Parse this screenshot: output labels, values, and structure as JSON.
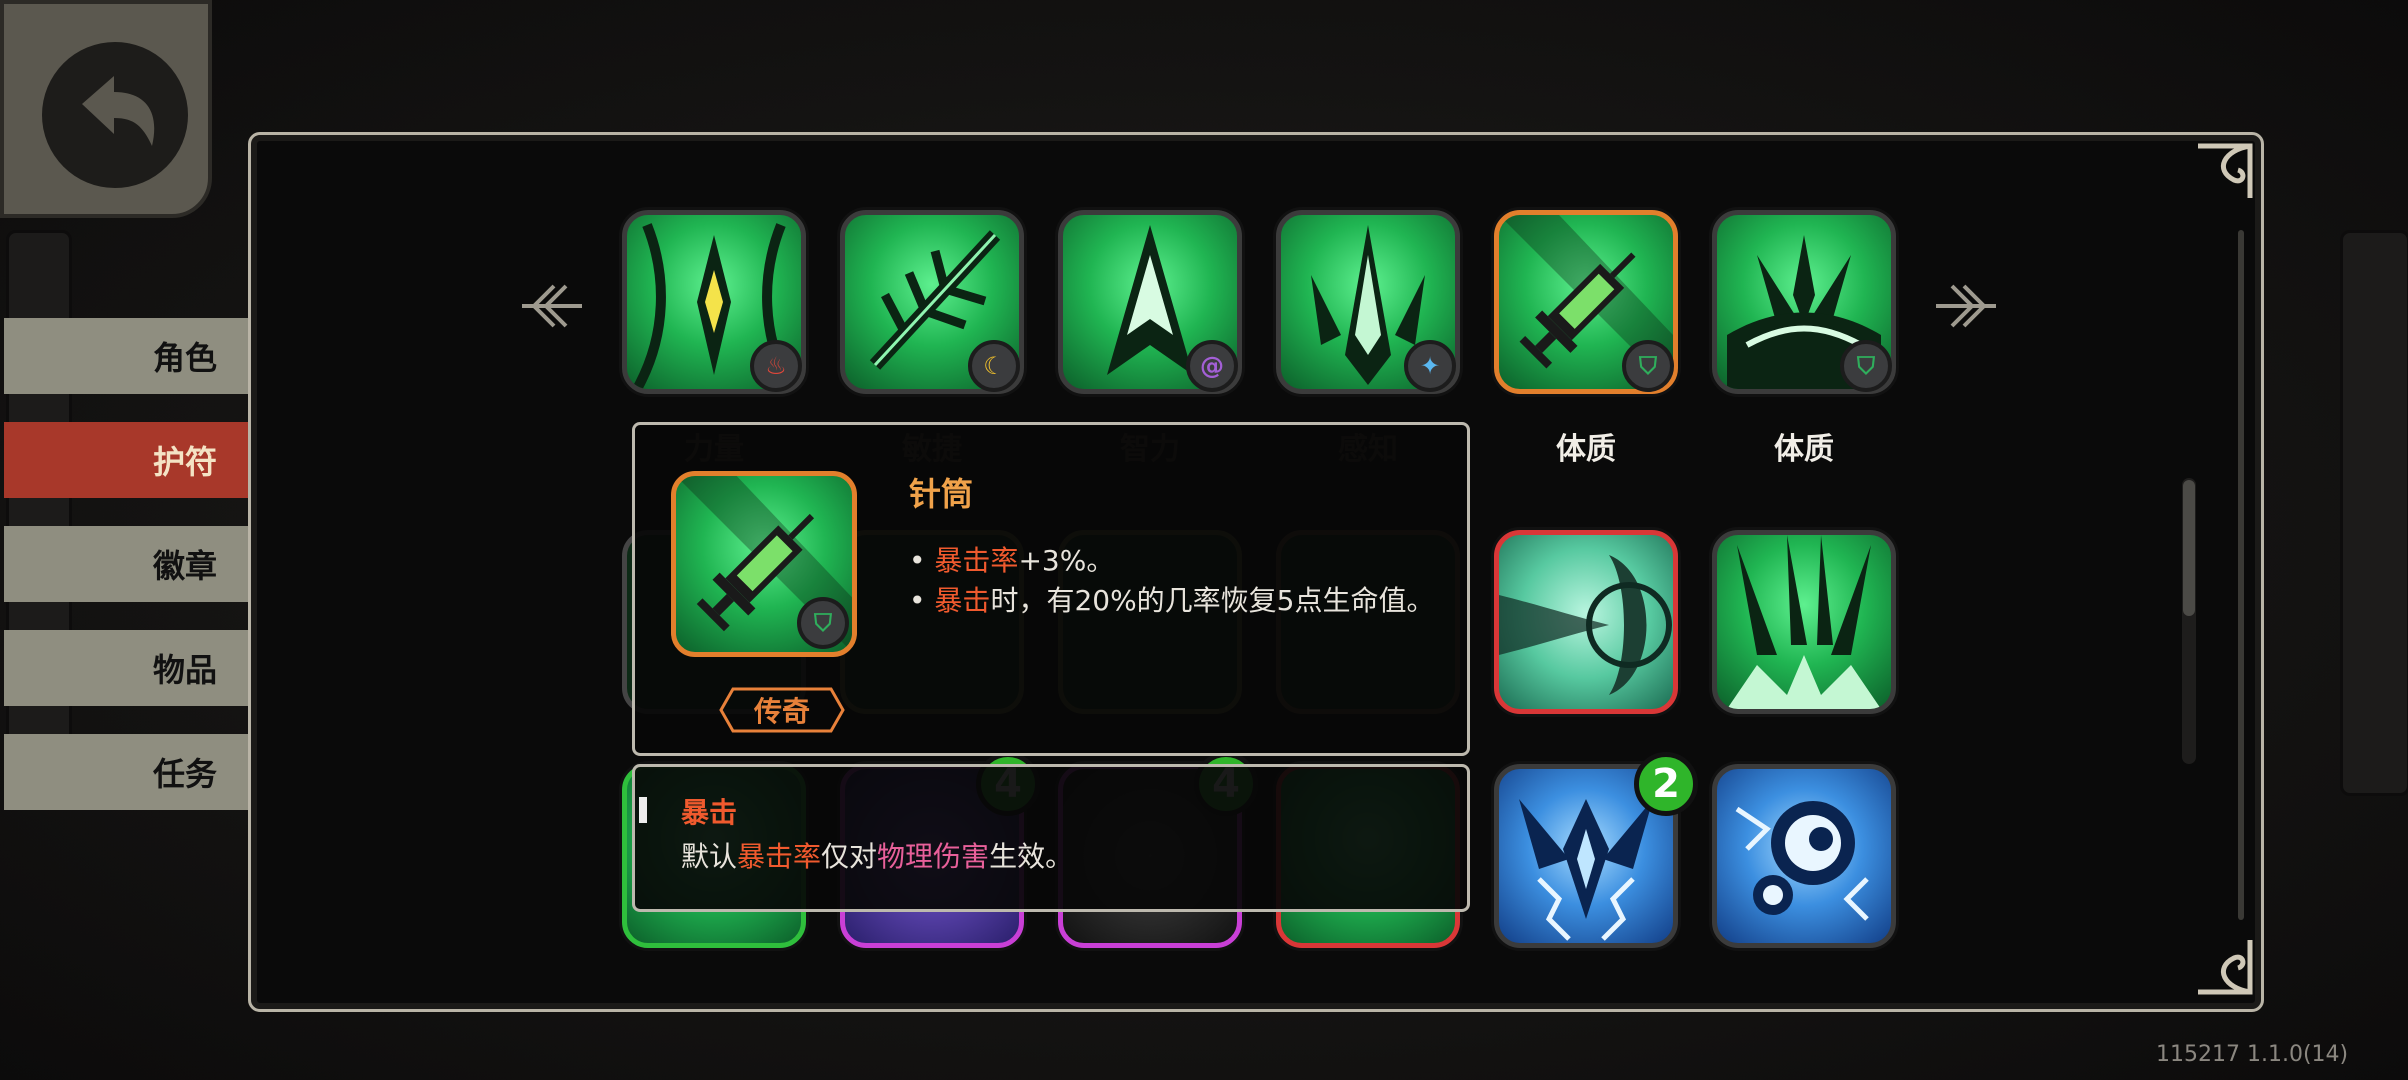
{
  "nav": {
    "back_label": "",
    "items": [
      {
        "label": "角色",
        "active": false
      },
      {
        "label": "护符",
        "active": true
      },
      {
        "label": "徽章",
        "active": false
      },
      {
        "label": "物品",
        "active": false
      },
      {
        "label": "任务",
        "active": false
      }
    ]
  },
  "talismans": {
    "row1": [
      {
        "label": "力量",
        "badge_icon": "flame-icon",
        "badge_color": "#e0473a"
      },
      {
        "label": "敏捷",
        "badge_icon": "crescent-icon",
        "badge_color": "#f0c02c"
      },
      {
        "label": "智力",
        "badge_icon": "swirl-icon",
        "badge_color": "#a35fd6"
      },
      {
        "label": "感知",
        "badge_icon": "star-icon",
        "badge_color": "#5ab7f0"
      },
      {
        "label": "体质",
        "badge_icon": "shield-icon",
        "badge_color": "#2fae5c"
      },
      {
        "label": "体质",
        "badge_icon": "shield-icon",
        "badge_color": "#2fae5c"
      }
    ],
    "row3_counts": [
      "4",
      "4",
      "2"
    ]
  },
  "popup": {
    "name": "针筒",
    "rarity": "传奇",
    "line1_prefix": "• ",
    "line1_hl": "暴击率",
    "line1_rest": "+3%。",
    "line2_prefix": "• ",
    "line2_hl": "暴击",
    "line2_rest": "时，有20%的几率恢复5点生命值。"
  },
  "keyword_popup": {
    "title": "暴击",
    "prefix": "默认",
    "hl1": "暴击率",
    "mid": "仅对",
    "hl2": "物理伤害",
    "suffix": "生效。"
  },
  "version": "115217 1.1.0(14)",
  "colors": {
    "accent_active_tab": "#a8382a",
    "highlight": "#f05a2e",
    "rarity_legendary": "#e27f2c"
  }
}
